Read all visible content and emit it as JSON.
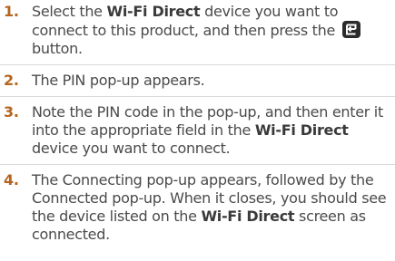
{
  "steps": [
    {
      "number": "1.",
      "t1": "Select the ",
      "b1": "Wi-Fi Direct",
      "t2": " device you want to connect to this product, and then press the ",
      "icon": "enter-button-icon",
      "t3": " button."
    },
    {
      "number": "2.",
      "text": "The PIN pop-up appears."
    },
    {
      "number": "3.",
      "t1": "Note the PIN code in the pop-up, and then enter it into the appropriate field in the ",
      "b1": "Wi-Fi Direct",
      "t2": " device you want to connect."
    },
    {
      "number": "4.",
      "t1": "The Connecting pop-up appears, followed by the Connected pop-up. When it closes, you should see the device listed on the ",
      "b1": "Wi-Fi Direct",
      "t2": " screen as connected."
    }
  ],
  "colors": {
    "step_number": "#b5651d",
    "body_text": "#4a4a4a",
    "divider": "#d9d9d9",
    "icon_bg": "#2b2b2b"
  }
}
